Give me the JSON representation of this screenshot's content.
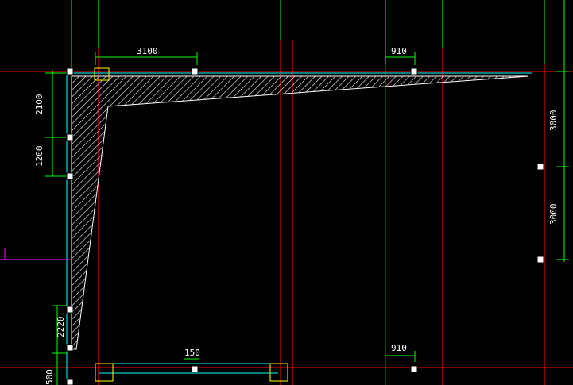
{
  "dimensions": {
    "top_3100": "3100",
    "top_910": "910",
    "left_2100": "2100",
    "left_1200": "1200",
    "left_2220": "2220",
    "left_500": "500",
    "right_3000_upper": "3000",
    "right_3000_lower": "3000",
    "bottom_150": "150",
    "bottom_910": "910"
  },
  "colors": {
    "background": "#000000",
    "axis_line": "#ff0000",
    "column_line": "#00ff00",
    "dimension_line": "#00ff00",
    "hatch": "#ffffff",
    "frame_line": "#00ffff",
    "marker": "#ffff00",
    "magenta": "#ff00ff"
  },
  "icons": {
    "grip": "square-grip-icon"
  }
}
